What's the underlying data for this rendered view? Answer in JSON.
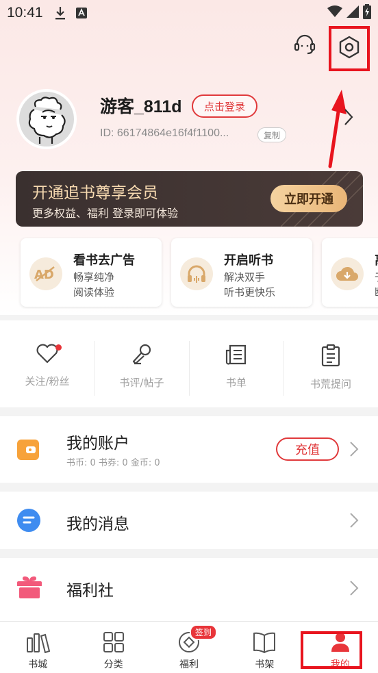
{
  "status_bar": {
    "time": "10:41",
    "icons": [
      "download-icon",
      "font-app-icon",
      "wifi-icon",
      "signal-icon",
      "battery-icon"
    ]
  },
  "header": {
    "service_icon": "headset-icon",
    "settings_icon": "settings-hexagon-icon"
  },
  "profile": {
    "username": "游客_811d",
    "login_label": "点击登录",
    "user_id": "ID: 66174864e16f4f1100...",
    "copy_label": "复制"
  },
  "vip": {
    "title": "开通追书尊享会员",
    "subtitle": "更多权益、福利 登录即可体验",
    "button": "立即开通"
  },
  "features": [
    {
      "title": "看书去广告",
      "line1": "畅享纯净",
      "line2": "阅读体验",
      "icon": "ad-free-icon"
    },
    {
      "title": "开启听书",
      "line1": "解决双手",
      "line2": "听书更快乐",
      "icon": "headphones-icon"
    },
    {
      "title": "离",
      "line1": "于",
      "line2": "断",
      "icon": "cloud-download-icon"
    }
  ],
  "shortcuts": [
    {
      "label": "关注/粉丝",
      "icon": "heart-icon",
      "has_dot": true
    },
    {
      "label": "书评/帖子",
      "icon": "microphone-icon"
    },
    {
      "label": "书单",
      "icon": "booklist-icon"
    },
    {
      "label": "书荒提问",
      "icon": "clipboard-icon"
    }
  ],
  "account": {
    "title": "我的账户",
    "balances": "书币: 0   书券: 0   金币: 0",
    "recharge": "充值"
  },
  "messages": {
    "title": "我的消息"
  },
  "welfare_club": {
    "title": "福利社"
  },
  "tabs": [
    {
      "label": "书城",
      "icon": "bookstore-icon"
    },
    {
      "label": "分类",
      "icon": "grid-icon"
    },
    {
      "label": "福利",
      "icon": "coin-icon",
      "badge": "签到"
    },
    {
      "label": "书架",
      "icon": "bookshelf-icon"
    },
    {
      "label": "我的",
      "icon": "user-icon",
      "active": true
    }
  ],
  "colors": {
    "accent": "#e8353a",
    "annotation": "#e8141e",
    "vip_bg": "#3a302f",
    "vip_gold": "#f6d9b0"
  }
}
